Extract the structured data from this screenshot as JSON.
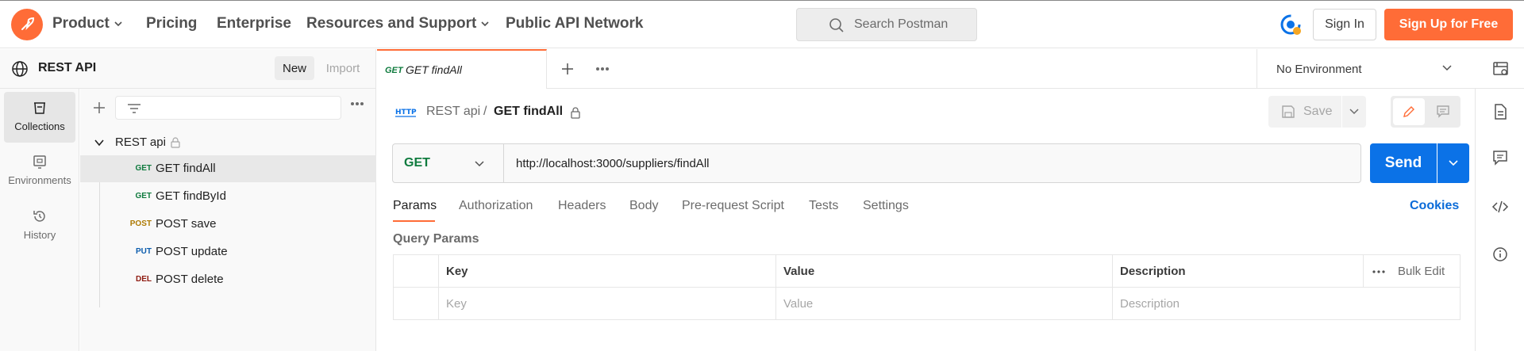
{
  "topnav": {
    "items": [
      {
        "label": "Product",
        "has_menu": true
      },
      {
        "label": "Pricing",
        "has_menu": false
      },
      {
        "label": "Enterprise",
        "has_menu": false
      },
      {
        "label": "Resources and Support",
        "has_menu": true
      },
      {
        "label": "Public API Network",
        "has_menu": false
      }
    ],
    "search_placeholder": "Search Postman",
    "sign_in": "Sign In",
    "sign_up": "Sign Up for Free",
    "accent_color": "#ff6c37"
  },
  "workspace": {
    "title": "REST API",
    "new_label": "New",
    "import_label": "Import"
  },
  "rail": {
    "items": [
      {
        "label": "Collections",
        "icon": "collections-icon",
        "active": true
      },
      {
        "label": "Environments",
        "icon": "environments-icon",
        "active": false
      },
      {
        "label": "History",
        "icon": "history-icon",
        "active": false
      }
    ]
  },
  "collection": {
    "name": "REST api",
    "requests": [
      {
        "method": "GET",
        "name": "GET findAll",
        "color": "#0f7b3e",
        "active": true
      },
      {
        "method": "GET",
        "name": "GET findById",
        "color": "#0f7b3e",
        "active": false
      },
      {
        "method": "POST",
        "name": "POST save",
        "color": "#ad7a03",
        "active": false
      },
      {
        "method": "PUT",
        "name": "POST update",
        "color": "#0b5cad",
        "active": false
      },
      {
        "method": "DEL",
        "name": "POST delete",
        "color": "#8e1a10",
        "active": false
      }
    ]
  },
  "tab": {
    "method": "GET",
    "name": "GET findAll"
  },
  "environment": {
    "selected": "No Environment"
  },
  "request": {
    "breadcrumb_parent": "REST api",
    "breadcrumb_sep": "/",
    "breadcrumb_current": "GET findAll",
    "save_label": "Save",
    "method": "GET",
    "url": "http://localhost:3000/suppliers/findAll",
    "send_label": "Send",
    "tabs": [
      "Params",
      "Authorization",
      "Headers",
      "Body",
      "Pre-request Script",
      "Tests",
      "Settings"
    ],
    "active_tab": "Params",
    "cookies_label": "Cookies",
    "query_params_label": "Query Params",
    "columns": [
      "Key",
      "Value",
      "Description"
    ],
    "placeholders": [
      "Key",
      "Value",
      "Description"
    ],
    "bulk_edit": "Bulk Edit"
  }
}
